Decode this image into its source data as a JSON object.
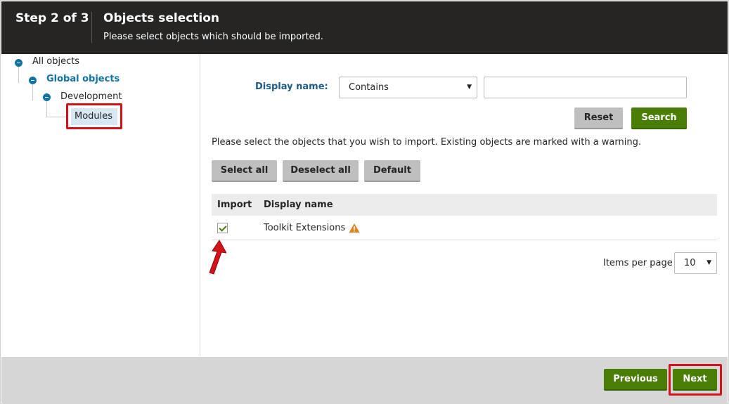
{
  "header": {
    "step": "Step 2 of 3",
    "title": "Objects selection",
    "subtitle": "Please select objects which should be imported."
  },
  "tree": {
    "root": "All objects",
    "global": "Global objects",
    "development": "Development",
    "modules": "Modules"
  },
  "filter": {
    "label": "Display name:",
    "operator": "Contains",
    "value": "",
    "reset_label": "Reset",
    "search_label": "Search"
  },
  "info_text": "Please select the objects that you wish to import. Existing objects are marked with a warning.",
  "actions": {
    "select_all": "Select all",
    "deselect_all": "Deselect all",
    "default": "Default"
  },
  "grid": {
    "columns": [
      "Import",
      "Display name"
    ],
    "rows": [
      {
        "checked": true,
        "name": "Toolkit Extensions",
        "warning": true
      }
    ]
  },
  "pager": {
    "label": "Items per page",
    "value": "10"
  },
  "footer": {
    "previous": "Previous",
    "next": "Next"
  },
  "colors": {
    "header_bg": "#262524",
    "accent_blue": "#1172a6",
    "green": "#497d04",
    "highlight_red": "#d2131a",
    "warning": "#e0841c"
  }
}
